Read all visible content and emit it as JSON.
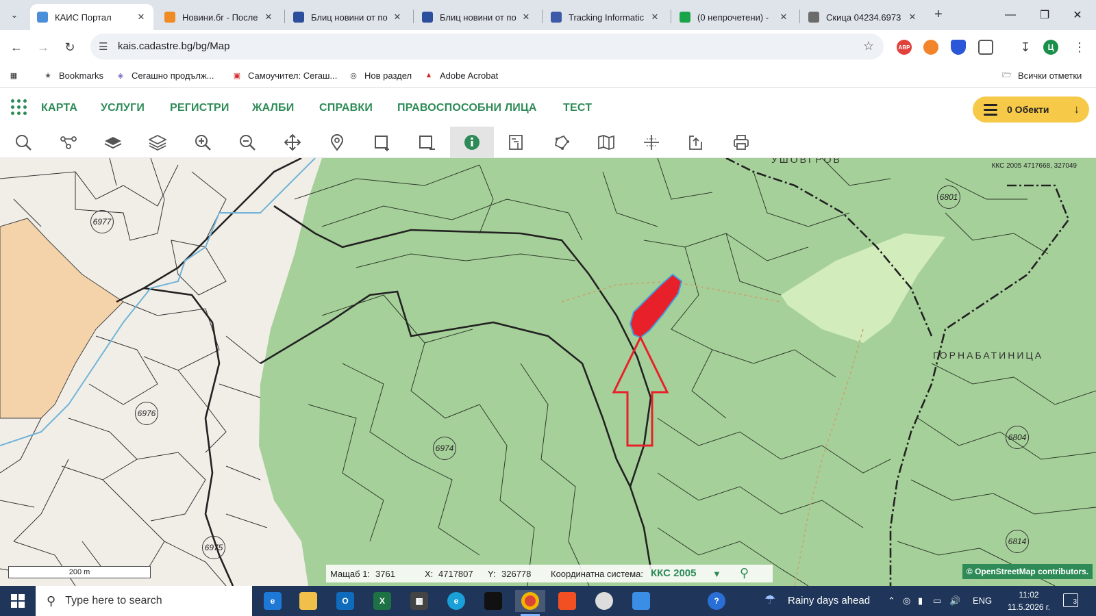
{
  "browser": {
    "tabs": [
      {
        "title": "КАИС Портал",
        "favicon": "kais-favicon-icon",
        "color": "#4a8fd8",
        "active": true
      },
      {
        "title": "Новини.бг - После",
        "favicon": "novini-favicon-icon",
        "color": "#f08a24",
        "active": false
      },
      {
        "title": "Блиц новини от по",
        "favicon": "blitz-favicon-icon",
        "color": "#2b4f9c",
        "active": false
      },
      {
        "title": "Блиц новини от по",
        "favicon": "blitz-favicon-icon",
        "color": "#2b4f9c",
        "active": false
      },
      {
        "title": "Tracking Informatic",
        "favicon": "tracking-favicon-icon",
        "color": "#3c5aa8",
        "active": false
      },
      {
        "title": "(0 непрочетени) -",
        "favicon": "mail-favicon-icon",
        "color": "#1aa44a",
        "active": false
      },
      {
        "title": "Скица 04234.6973",
        "favicon": "globe-favicon-icon",
        "color": "#6b6b6b",
        "active": false
      }
    ],
    "url": "kais.cadastre.bg/bg/Map",
    "bookmarks": [
      {
        "label": "Bookmarks",
        "icon": "star-icon"
      },
      {
        "label": "Сегашно продълж...",
        "icon": "cube-icon"
      },
      {
        "label": "Самоучител: Сегаш...",
        "icon": "ae-logo-icon"
      },
      {
        "label": "Нов раздел",
        "icon": "chrome-icon"
      },
      {
        "label": "Adobe Acrobat",
        "icon": "acrobat-icon"
      }
    ],
    "all_bookmarks": "Всички отметки",
    "profile_initial": "Ц",
    "abp_label": "ABP"
  },
  "app": {
    "menu": [
      "КАРТА",
      "УСЛУГИ",
      "РЕГИСТРИ",
      "ЖАЛБИ",
      "СПРАВКИ",
      "ПРАВОСПОСОБНИ ЛИЦА",
      "ТЕСТ"
    ],
    "objects_label": "0 Обекти",
    "accent_color": "#2e8b57",
    "objects_color": "#f7c948",
    "toolbar_tools": [
      "search-tool",
      "route-tool",
      "layer-tool",
      "layers-tool",
      "zoom-in-tool",
      "zoom-out-tool",
      "pan-tool",
      "location-pin-tool",
      "select-add-tool",
      "select-remove-tool",
      "info-tool",
      "measure-area-tool",
      "measure-polygon-tool",
      "map-tool",
      "coordinate-tool",
      "export-tool",
      "print-tool"
    ],
    "active_tool": "info-tool"
  },
  "map": {
    "top_coords": "ККС 2005 4717668, 327049",
    "labels": [
      "УШОВГРОВ",
      "ГОРНАБАТИНИЦА"
    ],
    "parcel_numbers": [
      "6977",
      "6976",
      "6974",
      "6975",
      "6801",
      "6804",
      "6814"
    ],
    "scale_bar": "200 m",
    "scale_label": "Мащаб 1:",
    "scale_value": "3761",
    "x_label": "X:",
    "x_value": "4717807",
    "y_label": "Y:",
    "y_value": "326778",
    "crs_label": "Координатна система:",
    "crs_value": "ККС 2005",
    "attribution": "© OpenStreetMap contributors.",
    "forest_color": "#a6d09a",
    "highlight_color": "#e8202a"
  },
  "taskbar": {
    "search_placeholder": "Type here to search",
    "weather": "Rainy days ahead",
    "language": "ENG",
    "time": "11:02",
    "date": "11.5.2026 г.",
    "notifications": "3"
  }
}
